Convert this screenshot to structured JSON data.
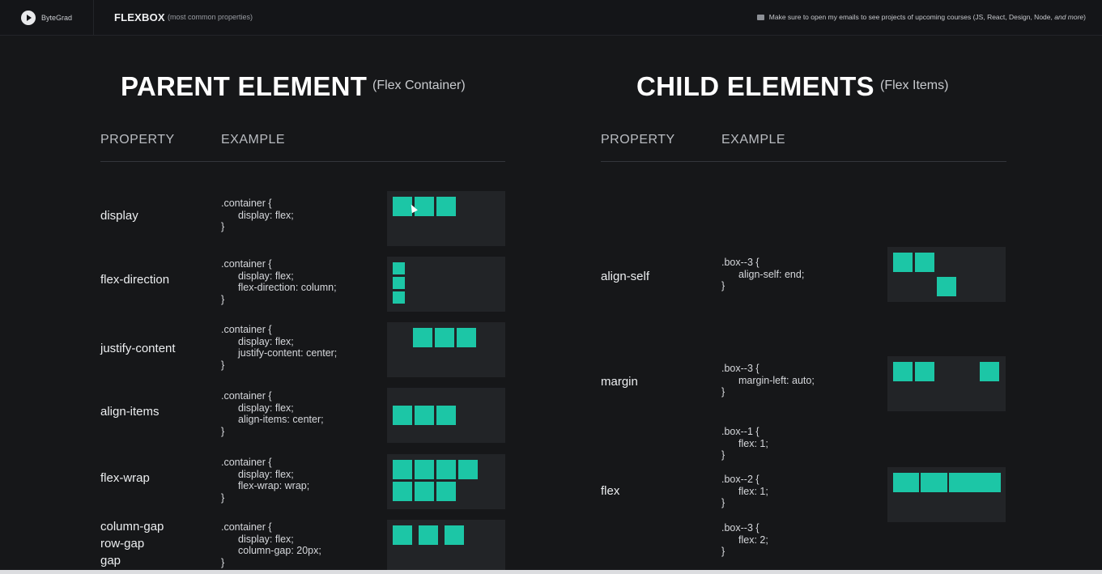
{
  "topbar": {
    "brand": "ByteGrad",
    "title": "FLEXBOX",
    "subtitle": "(most common properties)",
    "notice_main": "Make sure to open my emails to see projects of upcoming courses (JS, React, Design, Node, ",
    "notice_italic": "and more",
    "notice_end": ")"
  },
  "parent": {
    "title": "PARENT ELEMENT",
    "subtitle": "(Flex Container)",
    "col_property": "PROPERTY",
    "col_example": "EXAMPLE",
    "rows": [
      {
        "property": "display",
        "code": [
          ".container {",
          "display: flex;",
          "}"
        ]
      },
      {
        "property": "flex-direction",
        "code": [
          ".container {",
          "display: flex;",
          "flex-direction: column;",
          "}"
        ]
      },
      {
        "property": "justify-content",
        "code": [
          ".container {",
          "display: flex;",
          "justify-content: center;",
          "}"
        ]
      },
      {
        "property": "align-items",
        "code": [
          ".container {",
          "display: flex;",
          "align-items: center;",
          "}"
        ]
      },
      {
        "property": "flex-wrap",
        "code": [
          ".container {",
          "display: flex;",
          "flex-wrap: wrap;",
          "}"
        ]
      },
      {
        "property_lines": [
          "column-gap",
          "row-gap",
          "gap"
        ],
        "code": [
          ".container {",
          "display: flex;",
          "column-gap: 20px;",
          "}"
        ]
      }
    ]
  },
  "child": {
    "title": "CHILD ELEMENTS",
    "subtitle": "(Flex Items)",
    "col_property": "PROPERTY",
    "col_example": "EXAMPLE",
    "rows": [
      {
        "property": "align-self",
        "code": [
          ".box--3 {",
          "align-self: end;",
          "}"
        ]
      },
      {
        "property": "margin",
        "code": [
          ".box--3 {",
          "margin-left: auto;",
          "}"
        ]
      },
      {
        "property": "flex",
        "code_blocks": [
          [
            ".box--1 {",
            "flex: 1;",
            "}"
          ],
          [
            ".box--2 {",
            "flex: 1;",
            "}"
          ],
          [
            ".box--3 {",
            "flex: 2;",
            "}"
          ]
        ]
      }
    ]
  },
  "colors": {
    "accent": "#1cc6a6",
    "background": "#161719",
    "panel": "#222427"
  }
}
